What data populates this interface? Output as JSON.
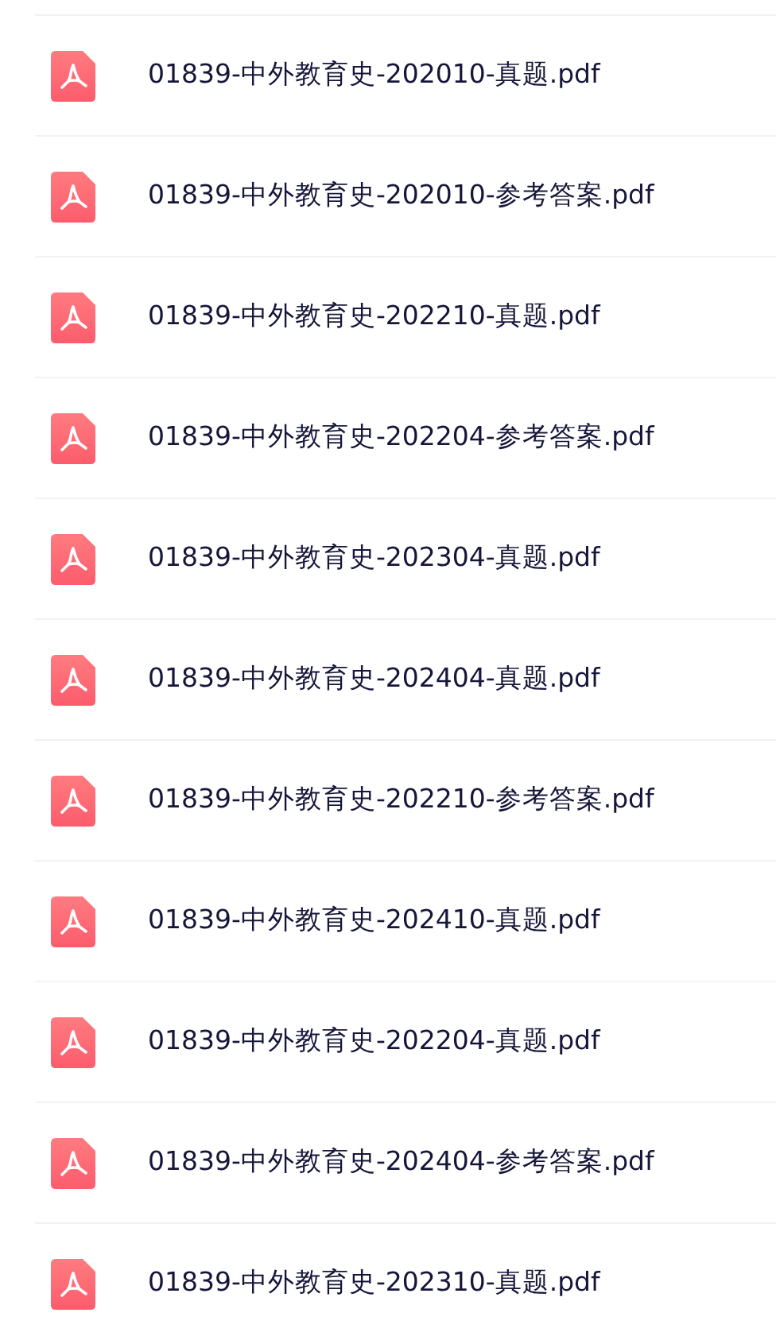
{
  "files": [
    {
      "name": "01839-中外教育史-202010-真题.pdf"
    },
    {
      "name": "01839-中外教育史-202010-参考答案.pdf"
    },
    {
      "name": "01839-中外教育史-202210-真题.pdf"
    },
    {
      "name": "01839-中外教育史-202204-参考答案.pdf"
    },
    {
      "name": "01839-中外教育史-202304-真题.pdf"
    },
    {
      "name": "01839-中外教育史-202404-真题.pdf"
    },
    {
      "name": "01839-中外教育史-202210-参考答案.pdf"
    },
    {
      "name": "01839-中外教育史-202410-真题.pdf"
    },
    {
      "name": "01839-中外教育史-202204-真题.pdf"
    },
    {
      "name": "01839-中外教育史-202404-参考答案.pdf"
    },
    {
      "name": "01839-中外教育史-202310-真题.pdf"
    }
  ]
}
